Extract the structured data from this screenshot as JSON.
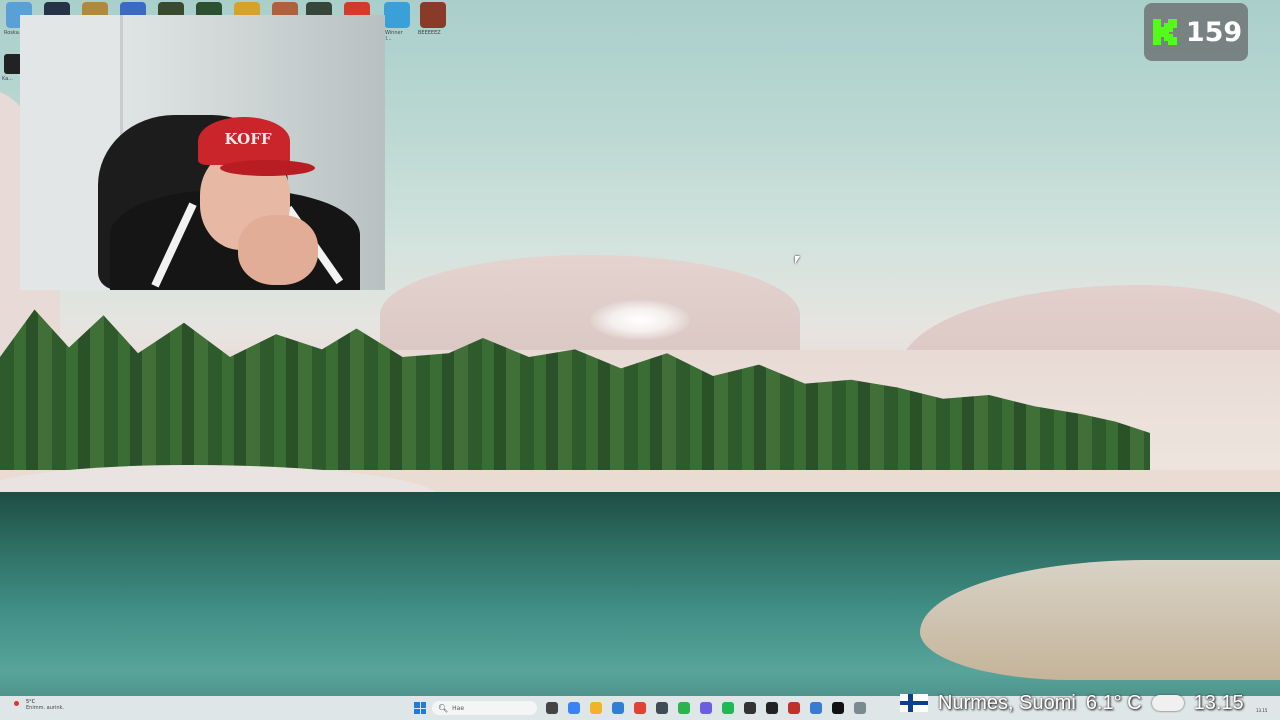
{
  "desktop": {
    "icons": [
      {
        "name": "recycle-bin-icon",
        "color": "#5aa0d8",
        "label": "Roska..."
      },
      {
        "name": "app-icon-2",
        "color": "#243446",
        "label": ""
      },
      {
        "name": "app-icon-3",
        "color": "#b08a3a",
        "label": ""
      },
      {
        "name": "app-icon-4",
        "color": "#3b6ac2",
        "label": ""
      },
      {
        "name": "app-icon-5",
        "color": "#3a4a2e",
        "label": ""
      },
      {
        "name": "app-icon-6",
        "color": "#2d5130",
        "label": ""
      },
      {
        "name": "app-icon-7",
        "color": "#d7a22a",
        "label": ""
      },
      {
        "name": "app-icon-8",
        "color": "#b0603a",
        "label": ""
      },
      {
        "name": "app-icon-9",
        "color": "#36463a",
        "label": ""
      },
      {
        "name": "app-icon-10",
        "color": "#d33a2a",
        "label": ""
      },
      {
        "name": "app-icon-11",
        "color": "#3aa0d8",
        "label": "yWinner Cl..."
      },
      {
        "name": "app-icon-12",
        "color": "#8a3a28",
        "label": "BEEEEEZ"
      }
    ],
    "left_icon_label": "Ka..."
  },
  "webcam": {
    "cap_text": "KOFF"
  },
  "kick": {
    "viewer_count": "159",
    "brand_color": "#53fc18"
  },
  "taskbar": {
    "weather_temp": "5°C",
    "weather_desc": "Enimm. aurink.",
    "search_placeholder": "Hae",
    "apps": [
      {
        "name": "task-view-icon",
        "color": "#444444"
      },
      {
        "name": "copilot-icon",
        "color": "#3b82f6"
      },
      {
        "name": "file-explorer-icon",
        "color": "#f0b429"
      },
      {
        "name": "edge-icon",
        "color": "#2f7fd6"
      },
      {
        "name": "chrome-icon",
        "color": "#e34133"
      },
      {
        "name": "app-icon-teal",
        "color": "#3e4c56"
      },
      {
        "name": "whatsapp-icon",
        "color": "#2bb350"
      },
      {
        "name": "discord-icon",
        "color": "#6b5ee0"
      },
      {
        "name": "spotify-icon",
        "color": "#1db954"
      },
      {
        "name": "game-icon",
        "color": "#333333"
      },
      {
        "name": "app-icon-dark",
        "color": "#222222"
      },
      {
        "name": "app-icon-red",
        "color": "#c0312a"
      },
      {
        "name": "app-icon-blue",
        "color": "#3a7ad0"
      },
      {
        "name": "capcut-icon",
        "color": "#111111"
      },
      {
        "name": "app-icon-gray",
        "color": "#7a8a90"
      }
    ],
    "tray_date": "13.15"
  },
  "overlay": {
    "location": "Nurmes, Suomi",
    "temperature": "6.1° C",
    "time": "13.15"
  }
}
